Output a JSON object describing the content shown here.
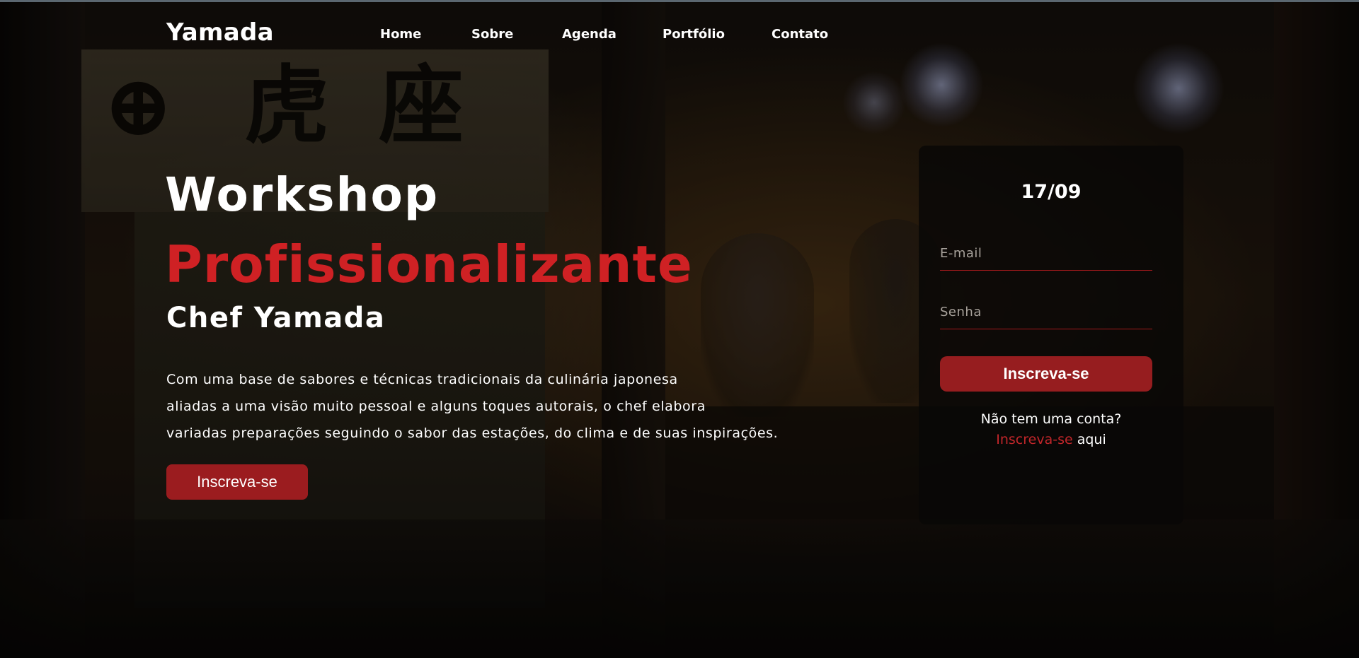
{
  "brand": {
    "name": "Yamada"
  },
  "nav": {
    "items": [
      {
        "label": "Home"
      },
      {
        "label": "Sobre"
      },
      {
        "label": "Agenda"
      },
      {
        "label": "Portfólio"
      },
      {
        "label": "Contato"
      }
    ]
  },
  "hero": {
    "title": "Workshop",
    "subtitle": "Profissionalizante",
    "chef": "Chef Yamada",
    "description_lines": [
      "Com uma base de sabores e técnicas tradicionais da culinária japonesa",
      "aliadas a uma visão muito pessoal e alguns toques autorais, o chef elabora",
      "variadas preparações seguindo o sabor das estações, do clima e de suas inspirações."
    ],
    "cta_label": "Inscreva-se"
  },
  "signup": {
    "date": "17/09",
    "email_placeholder": "E-mail",
    "password_placeholder": "Senha",
    "submit_label": "Inscreva-se",
    "no_account_text": "Não tem uma conta?",
    "signup_link": "Inscreva-se",
    "here_link": "aqui"
  },
  "colors": {
    "accent_red": "#cf2124",
    "button_red": "#9b1c1f",
    "text": "#ffffff"
  }
}
